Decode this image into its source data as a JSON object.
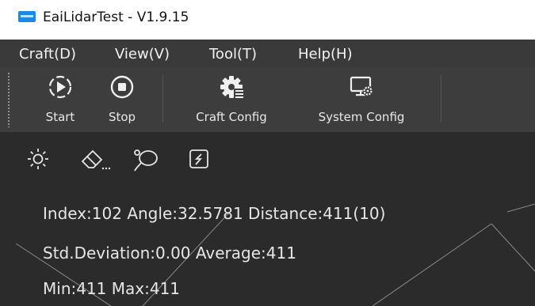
{
  "window": {
    "title": "EaiLidarTest - V1.9.15"
  },
  "menu": {
    "items": [
      "Craft(D)",
      "View(V)",
      "Tool(T)",
      "Help(H)"
    ]
  },
  "toolbar": {
    "start_label": "Start",
    "stop_label": "Stop",
    "craft_config_label": "Craft Config",
    "system_config_label": "System Config"
  },
  "view_tools": {
    "icons": [
      "brightness-icon",
      "eraser-icon",
      "lasso-icon",
      "edit-box-icon"
    ]
  },
  "info": {
    "line1": "Index:102 Angle:32.5781 Distance:411(10)",
    "line2": "Std.Deviation:0.00 Average:411",
    "line3": "Min:411 Max:411"
  },
  "colors": {
    "background": "#2b2b2b",
    "toolbar": "#3d3d3d",
    "menubar": "#3a3a3a",
    "text": "#e6e6e6"
  }
}
